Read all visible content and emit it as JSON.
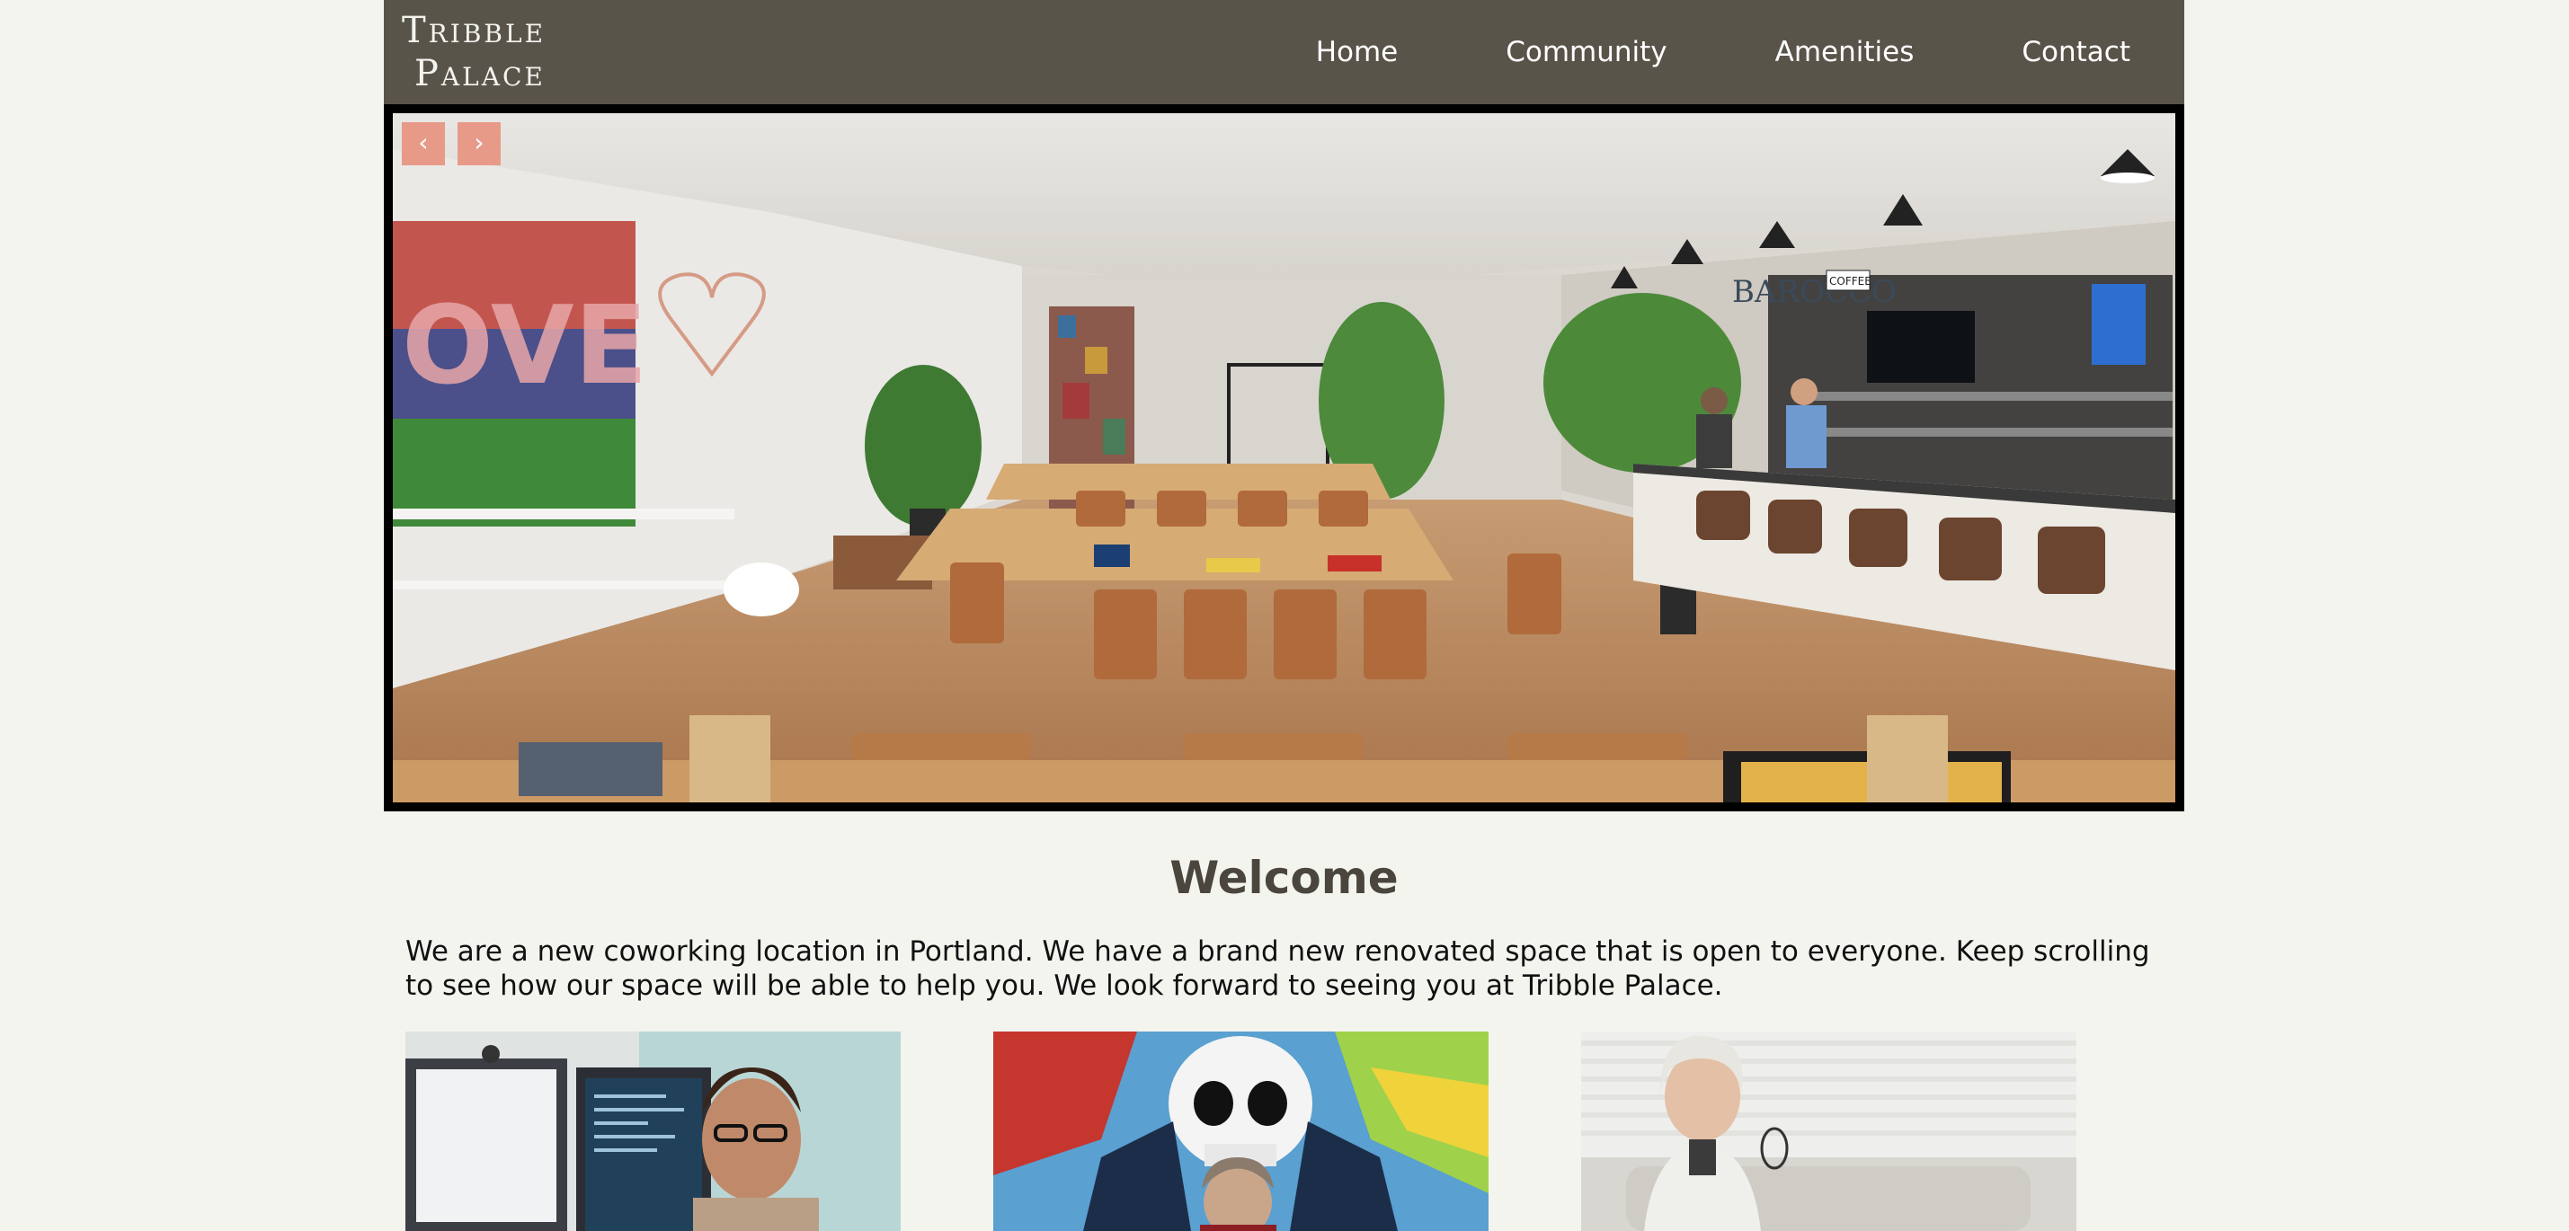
{
  "header": {
    "logo_line1": "Tribble",
    "logo_line2": "Palace",
    "nav": [
      "Home",
      "Community",
      "Amenities",
      "Contact"
    ]
  },
  "hero": {
    "prev_label": "‹",
    "next_label": "›",
    "sign_text": "BAROCCO",
    "sign_coffee": "COFFEE"
  },
  "welcome": {
    "title": "Welcome",
    "text": "We are a new coworking location in Portland. We have a brand new renovated space that is open to everyone. Keep scrolling to see how our space will be able to help you. We look forward to seeing you at Tribble Palace."
  },
  "colors": {
    "header_bg": "#59544a",
    "page_bg": "#f4f4ef",
    "slide_button": "#e89a89",
    "title": "#4a463d"
  }
}
